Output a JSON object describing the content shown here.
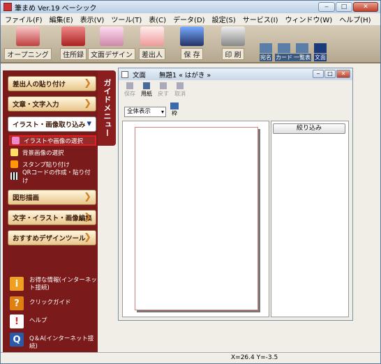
{
  "window": {
    "title": "筆まめ Ver.19 ベーシック",
    "min": "‒",
    "max": "□",
    "close": "✕"
  },
  "menu": [
    "ファイル(F)",
    "編集(E)",
    "表示(V)",
    "ツール(T)",
    "表(C)",
    "データ(D)",
    "設定(S)",
    "サービス(I)",
    "ウィンドウ(W)",
    "ヘルプ(H)"
  ],
  "toolbar": {
    "buttons": [
      "オープニング",
      "住所録",
      "文面デザイン",
      "差出人",
      "保 存",
      "印 刷"
    ],
    "views": [
      "宛名",
      "カード",
      "一覧表",
      "文面"
    ],
    "active_view": "文面"
  },
  "sidebar": {
    "guide_tab": "ガイドメニュー",
    "buttons": [
      "差出人の貼り付け",
      "文章・文字入力",
      "イラスト・画像取り込み",
      "図形描画",
      "文字・イラスト・画像編集",
      "おすすめデザインツール"
    ],
    "subitems": [
      "イラストや画像の選択",
      "背景画像の選択",
      "スタンプ貼り付け",
      "QRコードの作成・貼り付け"
    ],
    "links": [
      "お得な情報(インターネット接続)",
      "クリックガイド",
      "ヘルプ",
      "Q＆A(インターネット接続)"
    ],
    "link_icons": [
      "i",
      "?",
      "!",
      "Q"
    ]
  },
  "document": {
    "title": "文面　　無題1 « はがき »",
    "tools": [
      "保存",
      "用紙",
      "戻す",
      "取消"
    ],
    "zoom": "全体表示",
    "frame": "枠",
    "filter": "絞り込み"
  },
  "status": "X=26.4 Y=-3.5",
  "colors": {
    "sidebar": "#7a1a1a",
    "accent": "#d08020",
    "selection": "#e02020"
  }
}
